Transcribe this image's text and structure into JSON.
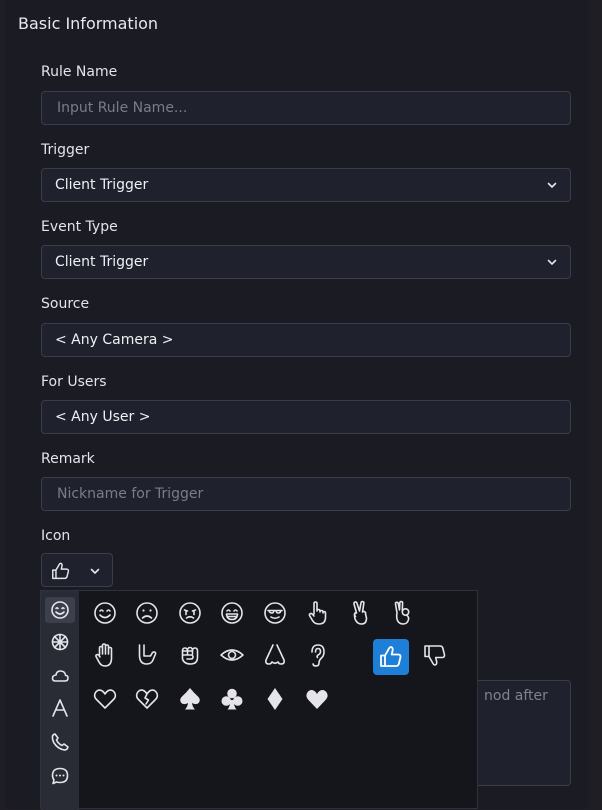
{
  "section": {
    "title": "Basic Information"
  },
  "form": {
    "rule_name": {
      "label": "Rule Name",
      "placeholder": "Input Rule Name..."
    },
    "trigger": {
      "label": "Trigger",
      "value": "Client Trigger"
    },
    "event_type": {
      "label": "Event Type",
      "value": "Client Trigger"
    },
    "source": {
      "label": "Source",
      "value": "< Any Camera >"
    },
    "for_users": {
      "label": "For Users",
      "value": "< Any User >"
    },
    "remark": {
      "label": "Remark",
      "placeholder": "Nickname for Trigger"
    },
    "icon": {
      "label": "Icon",
      "value": "thumbs-up-icon"
    }
  },
  "background_text": "nod after",
  "icon_picker": {
    "categories": [
      "smiley-face-icon",
      "activity-icon",
      "cloud-icon",
      "text-letter-icon",
      "phone-icon",
      "chat-bubble-icon"
    ],
    "active_category": "smiley-face-icon",
    "icons": [
      "smiling-face-icon",
      "sad-face-icon",
      "crying-face-icon",
      "laughing-face-icon",
      "cool-face-icon",
      "pointing-hand-icon",
      "victory-hand-icon",
      "ok-hand-icon",
      "open-hand-icon",
      "thumb-hand-icon",
      "fist-icon",
      "eye-icon",
      "nose-icon",
      "ear-icon",
      "thumbs-up-icon",
      "thumbs-down-icon",
      "heart-outline-icon",
      "broken-heart-icon",
      "spade-icon",
      "club-icon",
      "diamond-icon",
      "heart-filled-icon"
    ],
    "selected_icon": "thumbs-up-icon",
    "selected_color": "#1e7fd8"
  }
}
